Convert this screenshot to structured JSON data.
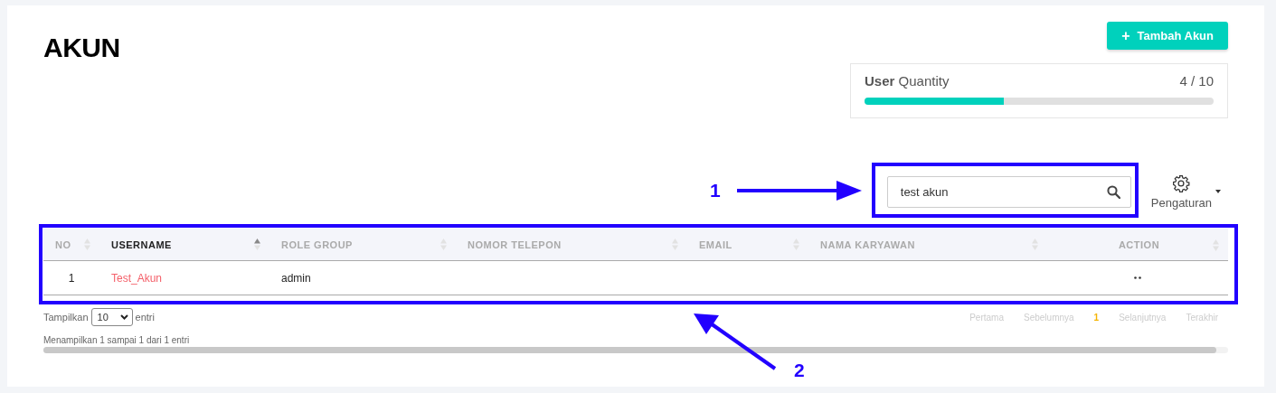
{
  "page": {
    "title": "AKUN"
  },
  "add_button": {
    "icon": "+",
    "label": "Tambah Akun"
  },
  "quantity": {
    "label_bold": "User",
    "label": "Quantity",
    "reading": "4 / 10",
    "level": 0.4
  },
  "search": {
    "value": "test akun"
  },
  "settings": {
    "label": "Pengaturan"
  },
  "table": {
    "columns": [
      {
        "label": "NO",
        "sorted": false
      },
      {
        "label": "USERNAME",
        "sorted": true
      },
      {
        "label": "ROLE GROUP",
        "sorted": false
      },
      {
        "label": "NOMOR TELEPON",
        "sorted": false
      },
      {
        "label": "EMAIL",
        "sorted": false
      },
      {
        "label": "NAMA KARYAWAN",
        "sorted": false
      },
      {
        "label": "ACTION",
        "sorted": false
      }
    ],
    "rows": [
      {
        "cells": [
          {
            "kind": "num",
            "text": "1"
          },
          {
            "kind": "link",
            "text": "Test_Akun"
          },
          {
            "kind": "text",
            "text": "admin"
          },
          {
            "kind": "blank"
          },
          {
            "kind": "blank"
          },
          {
            "kind": "blank"
          },
          {
            "kind": "action"
          }
        ]
      }
    ]
  },
  "length": {
    "prefix": "Tampilkan",
    "value": "10",
    "suffix": "entri"
  },
  "info": "Menampilkan 1 sampai 1 dari 1 entri",
  "pagination": [
    {
      "label": "Pertama",
      "selected": false
    },
    {
      "label": "Sebelumnya",
      "selected": false
    },
    {
      "label": "1",
      "selected": true
    },
    {
      "label": "Selanjutnya",
      "selected": false
    },
    {
      "label": "Terakhir",
      "selected": false
    }
  ],
  "annotations": [
    {
      "label": "1"
    },
    {
      "label": "2"
    }
  ]
}
